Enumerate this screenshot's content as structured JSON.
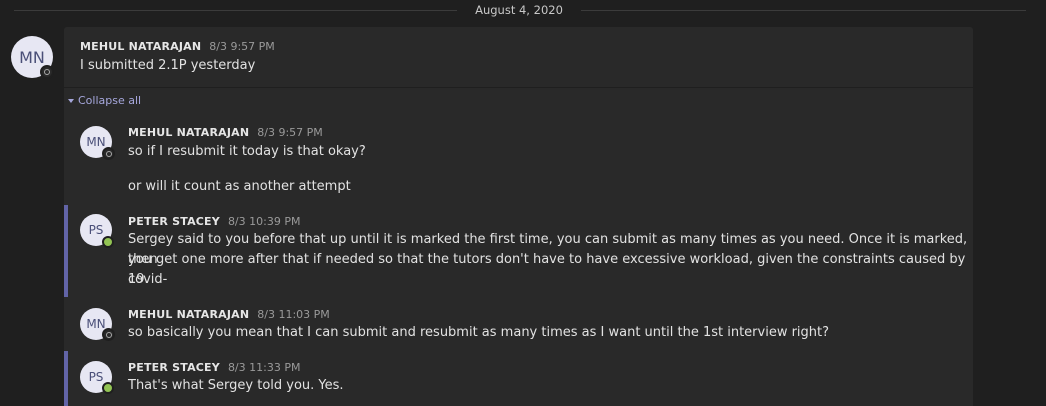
{
  "date_divider": "August 4, 2020",
  "root": {
    "initials": "MN",
    "author": "MEHUL NATARAJAN",
    "time": "8/3 9:57 PM",
    "text": "I submitted 2.1P yesterday"
  },
  "collapse_label": "Collapse all",
  "replies": [
    {
      "initials": "MN",
      "author": "MEHUL NATARAJAN",
      "time": "8/3 9:57 PM",
      "lines": [
        "so if I resubmit it today is that okay?",
        "",
        "or will it count as another attempt"
      ],
      "status": "offline"
    },
    {
      "initials": "PS",
      "author": "PETER STACEY",
      "time": "8/3 10:39 PM",
      "lines": [
        "Sergey said to you before that up until it is marked the first time, you can submit as many times as you need. Once it is marked, then",
        "you get one more after that if needed so that the tutors don't have to have excessive workload, given the constraints caused by covid-",
        "19."
      ],
      "status": "available"
    },
    {
      "initials": "MN",
      "author": "MEHUL NATARAJAN",
      "time": "8/3 11:03 PM",
      "lines": [
        "so basically you mean that I can submit and resubmit as many times as I want until the 1st interview right?"
      ],
      "status": "offline"
    },
    {
      "initials": "PS",
      "author": "PETER STACEY",
      "time": "8/3 11:33 PM",
      "lines": [
        "That's what Sergey told you. Yes."
      ],
      "status": "available"
    }
  ]
}
